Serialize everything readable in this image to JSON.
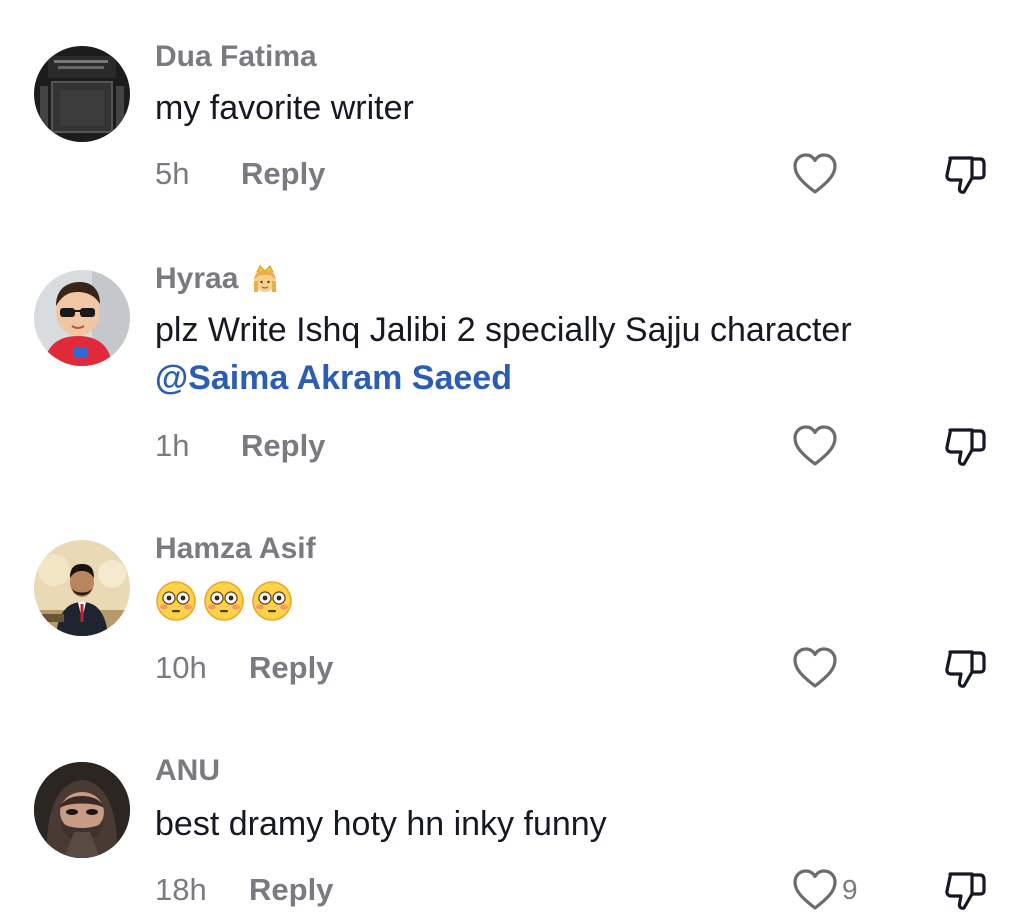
{
  "comments": [
    {
      "author": "Dua Fatima",
      "text": "my favorite writer",
      "time": "5h",
      "reply_label": "Reply",
      "avatar_icon": "dark-frame-avatar",
      "like_icon": "heart-outline-icon",
      "dislike_icon": "thumbs-down-icon"
    },
    {
      "author": "Hyraa",
      "author_badge_icon": "princess-emoji-icon",
      "text": "plz Write Ishq Jalibi 2 specially Sajju character",
      "mention": "@Saima Akram Saeed",
      "time": "1h",
      "reply_label": "Reply",
      "avatar_icon": "child-with-sunglasses-avatar",
      "like_icon": "heart-outline-icon",
      "dislike_icon": "thumbs-down-icon"
    },
    {
      "author": "Hamza Asif",
      "emojis": [
        "flushed-face-emoji",
        "flushed-face-emoji",
        "flushed-face-emoji"
      ],
      "time": "10h",
      "reply_label": "Reply",
      "avatar_icon": "man-in-suit-avatar",
      "like_icon": "heart-outline-icon",
      "dislike_icon": "thumbs-down-icon"
    },
    {
      "author": "ANU",
      "text": "best dramy hoty hn inky funny",
      "time": "18h",
      "reply_label": "Reply",
      "like_count": "9",
      "avatar_icon": "woman-with-hijab-avatar",
      "like_icon": "heart-outline-icon",
      "dislike_icon": "thumbs-down-icon"
    }
  ],
  "colors": {
    "text_primary": "#161823",
    "text_secondary": "#7a7a80",
    "mention": "#2b5db3",
    "background": "#ffffff"
  }
}
